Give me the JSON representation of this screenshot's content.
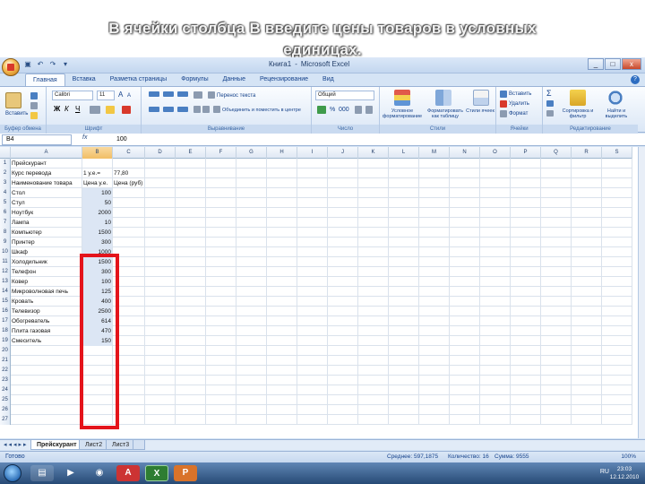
{
  "slide_title": {
    "line1": "В ячейки столбца В введите цены товаров в условных",
    "line2": "единицах."
  },
  "window": {
    "doc_name": "Книга1",
    "app_name": "Microsoft Excel",
    "controls": [
      "_",
      "□",
      "x"
    ]
  },
  "ribbon": {
    "tabs": [
      "Главная",
      "Вставка",
      "Разметка страницы",
      "Формулы",
      "Данные",
      "Рецензирование",
      "Вид"
    ],
    "active_tab": 0,
    "font_name": "Calibri",
    "font_size": "11",
    "number_format": "Общий",
    "wrap_text": "Перенос текста",
    "merge_center": "Объединить и поместить в центре",
    "paste": "Вставить",
    "cond_format": "Условное форматирование",
    "format_table": "Форматировать как таблицу",
    "cell_styles": "Стили ячеек",
    "insert": "Вставить",
    "delete": "Удалить",
    "format": "Формат",
    "sort_filter": "Сортировка и фильтр",
    "find_select": "Найти и выделить",
    "groups": [
      "Буфер обмена",
      "Шрифт",
      "Выравнивание",
      "Число",
      "Стили",
      "Ячейки",
      "Редактирование"
    ]
  },
  "formula_bar": {
    "name_box": "B4",
    "fx": "fx",
    "value": "100"
  },
  "columns": [
    "A",
    "B",
    "C",
    "D",
    "E",
    "F",
    "G",
    "H",
    "I",
    "J",
    "K",
    "L",
    "M",
    "N",
    "O",
    "P",
    "Q",
    "R",
    "S"
  ],
  "selected_column": "B",
  "rows": [
    {
      "n": "1",
      "a": "Прейскурант",
      "b": "",
      "c": ""
    },
    {
      "n": "2",
      "a": "Курс перевода",
      "b": "1 у.е.=",
      "c": "77,80"
    },
    {
      "n": "3",
      "a": "Наименование товара",
      "b": "Цена у.е.",
      "c": "Цена (руб)"
    },
    {
      "n": "4",
      "a": "Стол",
      "b": "100",
      "c": ""
    },
    {
      "n": "5",
      "a": "Стул",
      "b": "50",
      "c": ""
    },
    {
      "n": "6",
      "a": "Ноутбук",
      "b": "2000",
      "c": ""
    },
    {
      "n": "7",
      "a": "Лампа",
      "b": "10",
      "c": ""
    },
    {
      "n": "8",
      "a": "Компьютер",
      "b": "1500",
      "c": ""
    },
    {
      "n": "9",
      "a": "Принтер",
      "b": "300",
      "c": ""
    },
    {
      "n": "10",
      "a": "Шкаф",
      "b": "1000",
      "c": ""
    },
    {
      "n": "11",
      "a": "Холодильник",
      "b": "1500",
      "c": ""
    },
    {
      "n": "12",
      "a": "Телефон",
      "b": "300",
      "c": ""
    },
    {
      "n": "13",
      "a": "Ковер",
      "b": "100",
      "c": ""
    },
    {
      "n": "14",
      "a": "Микроволновая печь",
      "b": "125",
      "c": ""
    },
    {
      "n": "15",
      "a": "Кровать",
      "b": "400",
      "c": ""
    },
    {
      "n": "16",
      "a": "Телевизор",
      "b": "2500",
      "c": ""
    },
    {
      "n": "17",
      "a": "Обогреватель",
      "b": "614",
      "c": ""
    },
    {
      "n": "18",
      "a": "Плита газовая",
      "b": "470",
      "c": ""
    },
    {
      "n": "19",
      "a": "Смеситель",
      "b": "150",
      "c": ""
    },
    {
      "n": "20",
      "a": "",
      "b": "",
      "c": ""
    },
    {
      "n": "21",
      "a": "",
      "b": "",
      "c": ""
    },
    {
      "n": "22",
      "a": "",
      "b": "",
      "c": ""
    },
    {
      "n": "23",
      "a": "",
      "b": "",
      "c": ""
    },
    {
      "n": "24",
      "a": "",
      "b": "",
      "c": ""
    },
    {
      "n": "25",
      "a": "",
      "b": "",
      "c": ""
    },
    {
      "n": "26",
      "a": "",
      "b": "",
      "c": ""
    },
    {
      "n": "27",
      "a": "",
      "b": "",
      "c": ""
    }
  ],
  "sheet_tabs": [
    "Прейскурант",
    "Лист2",
    "Лист3"
  ],
  "active_sheet": 0,
  "status": {
    "ready": "Готово",
    "average": "Среднее: 597,1875",
    "count": "Количество: 16",
    "sum": "Сумма: 9555",
    "zoom": "100%"
  },
  "taskbar": {
    "lang": "RU",
    "time": "23:03",
    "date": "12.12.2010"
  },
  "colors": {
    "highlight": "#e4141b",
    "selected_fill": "#dce6f4",
    "accent": "#15428b"
  }
}
